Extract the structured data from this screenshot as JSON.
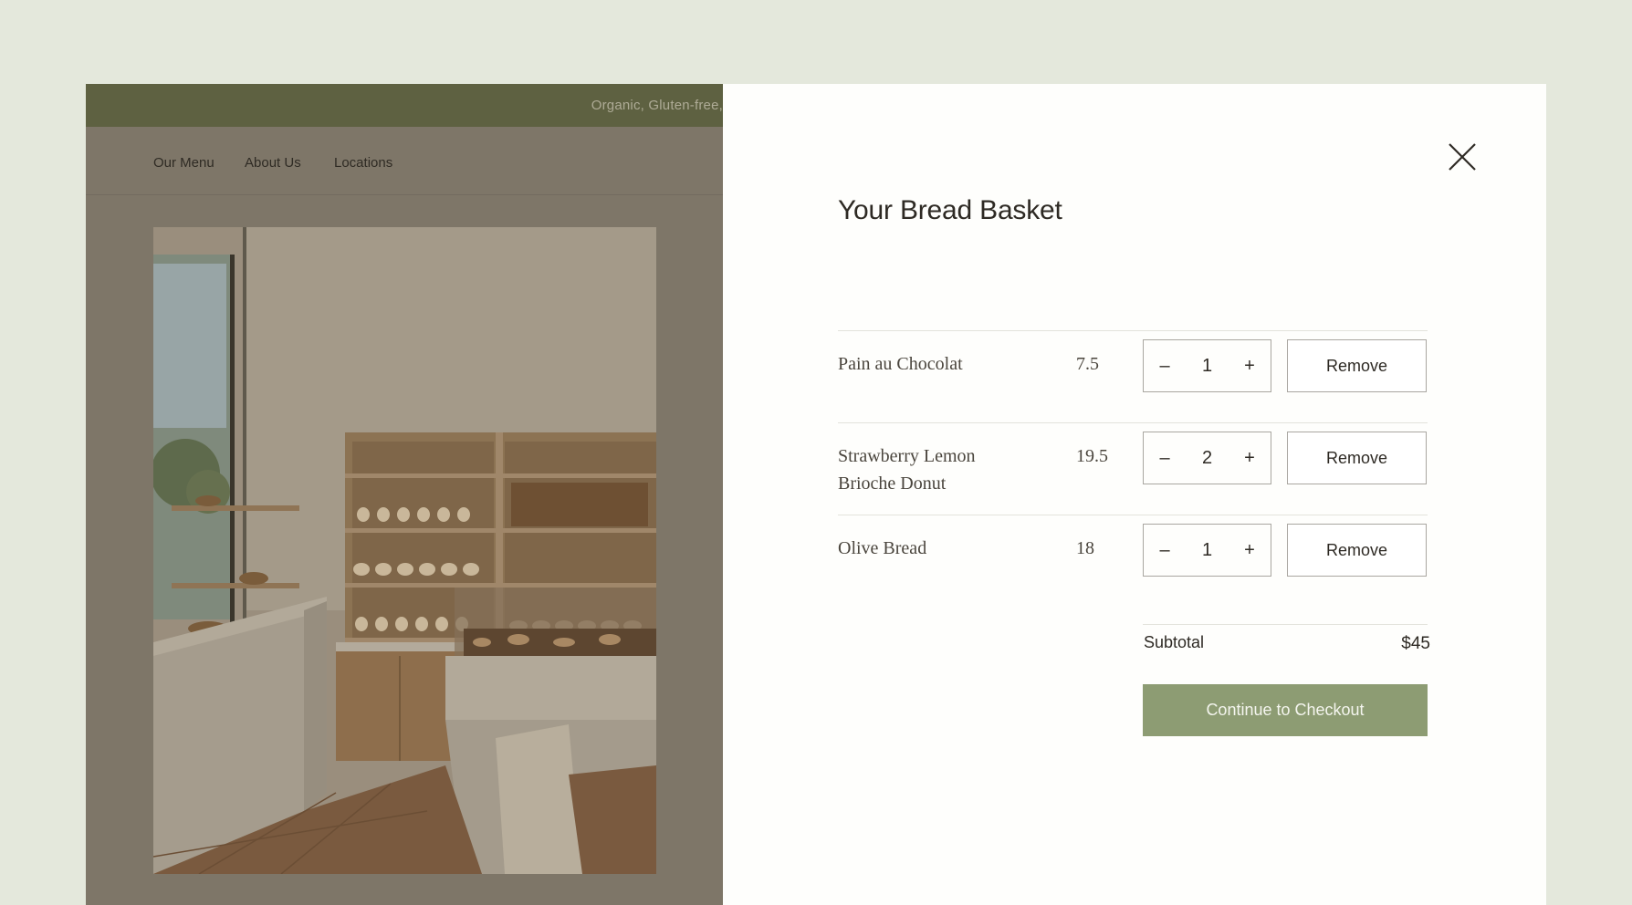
{
  "site": {
    "announcement": "Organic, Gluten-free,",
    "nav": [
      "Our Menu",
      "About Us",
      "Locations"
    ]
  },
  "cart": {
    "title": "Your Bread Basket",
    "items": [
      {
        "name": "Pain au Chocolat",
        "price": "7.5",
        "qty": "1",
        "remove_label": "Remove"
      },
      {
        "name": "Strawberry Lemon Brioche Donut",
        "price": "19.5",
        "qty": "2",
        "remove_label": "Remove"
      },
      {
        "name": "Olive Bread",
        "price": "18",
        "qty": "1",
        "remove_label": "Remove"
      }
    ],
    "decrement_symbol": "–",
    "increment_symbol": "+",
    "subtotal_label": "Subtotal",
    "subtotal_value": "$45",
    "checkout_label": "Continue to Checkout"
  },
  "colors": {
    "page_bg": "#e4e8dc",
    "announcement_bg": "#5e6141",
    "overlay_bg": "#7e7668",
    "accent_button": "#8d9c73",
    "drawer_bg": "#fefefc"
  },
  "icons": {
    "close": "close-icon",
    "minus": "minus-icon",
    "plus": "plus-icon"
  }
}
